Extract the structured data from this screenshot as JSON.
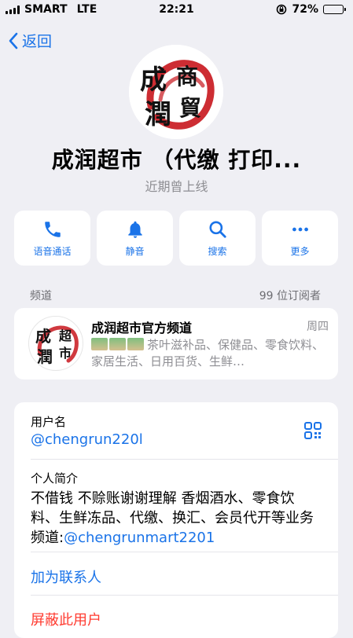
{
  "status_bar": {
    "carrier": "SMART",
    "network": "LTE",
    "time": "22:21",
    "battery": "72%",
    "battery_level": 0.72
  },
  "nav": {
    "back_label": "返回"
  },
  "profile": {
    "name": "成润超市 （代缴 打印...",
    "status": "近期曾上线",
    "avatar_icon": "chengrun-logo-icon"
  },
  "actions": [
    {
      "label": "语音通话",
      "icon": "phone-icon"
    },
    {
      "label": "静音",
      "icon": "bell-icon"
    },
    {
      "label": "搜索",
      "icon": "search-icon"
    },
    {
      "label": "更多",
      "icon": "more-icon"
    }
  ],
  "channel_section": {
    "header": "频道",
    "subscribers": "99 位订阅者",
    "name": "成润超市官方频道",
    "day": "周四",
    "preview": "茶叶滋补品、保健品、零食饮料、家居生活、日用百货、生鲜…"
  },
  "info": {
    "username_label": "用户名",
    "username": "@chengrun220l",
    "bio_label": "个人简介",
    "bio_text": "不借钱 不赊账谢谢理解 香烟酒水、零食饮料、生鲜冻品、代缴、换汇、会员代开等业务频道:",
    "bio_link": "@chengrunmart2201",
    "add_contact": "加为联系人",
    "block_user": "屏蔽此用户"
  },
  "colors": {
    "accent": "#1a73e8",
    "danger": "#ff3b30",
    "background": "#efeff4"
  }
}
